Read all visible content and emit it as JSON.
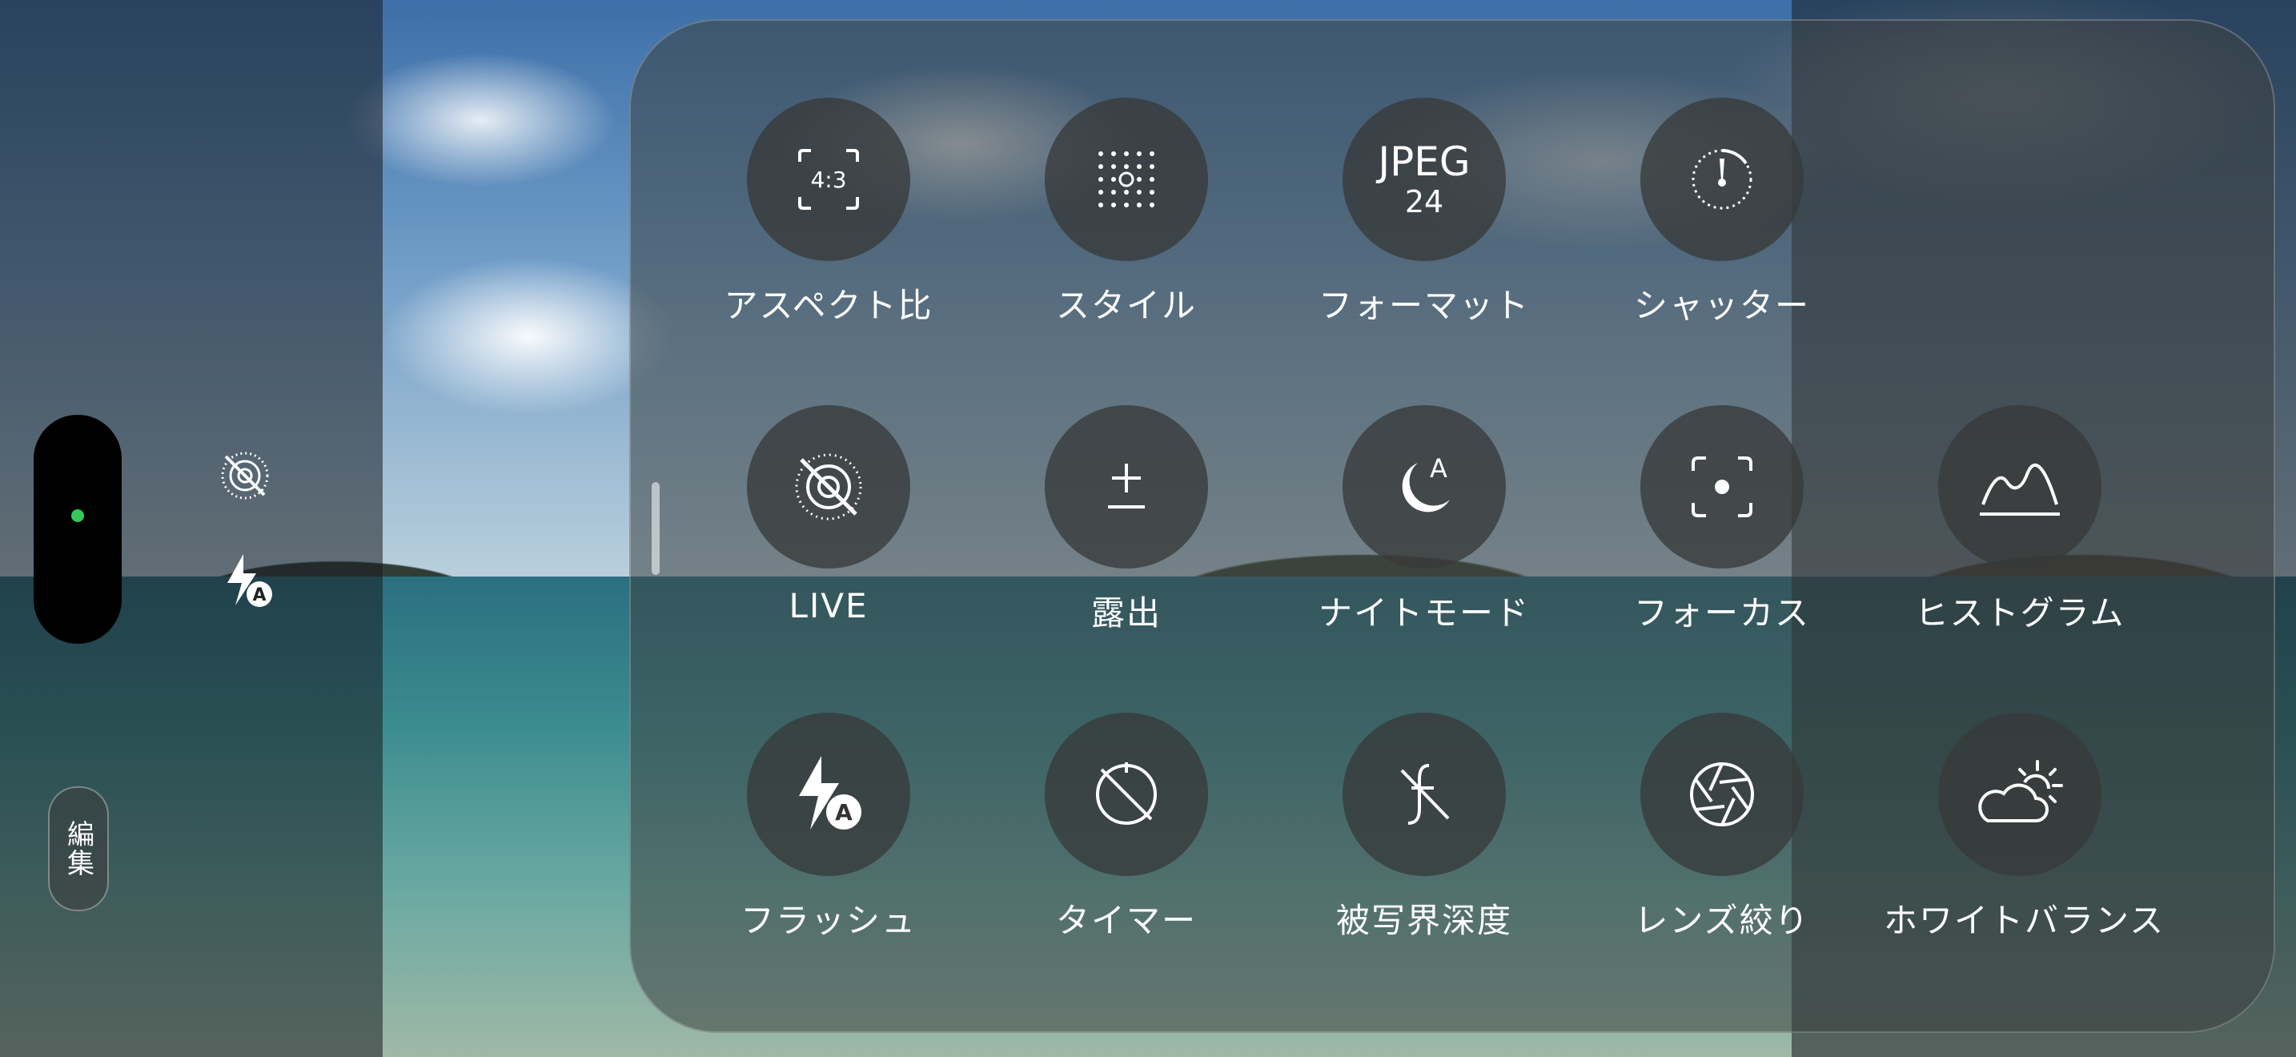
{
  "side": {
    "edit_label": "編集"
  },
  "controls": [
    {
      "label": "アスペクト比",
      "icon": "aspect-ratio-icon",
      "icon_text": "4:3"
    },
    {
      "label": "スタイル",
      "icon": "style-grid-icon"
    },
    {
      "label": "フォーマット",
      "icon": "format-jpeg-icon",
      "icon_text_1": "JPEG",
      "icon_text_2": "24"
    },
    {
      "label": "シャッター",
      "icon": "shutter-icon"
    },
    {
      "label": "LIVE",
      "icon": "live-off-icon"
    },
    {
      "label": "露出",
      "icon": "exposure-icon"
    },
    {
      "label": "ナイトモード",
      "icon": "night-mode-icon",
      "icon_text": "A"
    },
    {
      "label": "フォーカス",
      "icon": "focus-icon"
    },
    {
      "label": "ヒストグラム",
      "icon": "histogram-icon"
    },
    {
      "label": "フラッシュ",
      "icon": "flash-auto-icon",
      "icon_text": "A"
    },
    {
      "label": "タイマー",
      "icon": "timer-off-icon"
    },
    {
      "label": "被写界深度",
      "icon": "depth-of-field-icon"
    },
    {
      "label": "レンズ絞り",
      "icon": "aperture-icon"
    },
    {
      "label": "ホワイトバランス",
      "icon": "white-balance-icon"
    }
  ],
  "colors": {
    "live_indicator": "#34c759"
  }
}
